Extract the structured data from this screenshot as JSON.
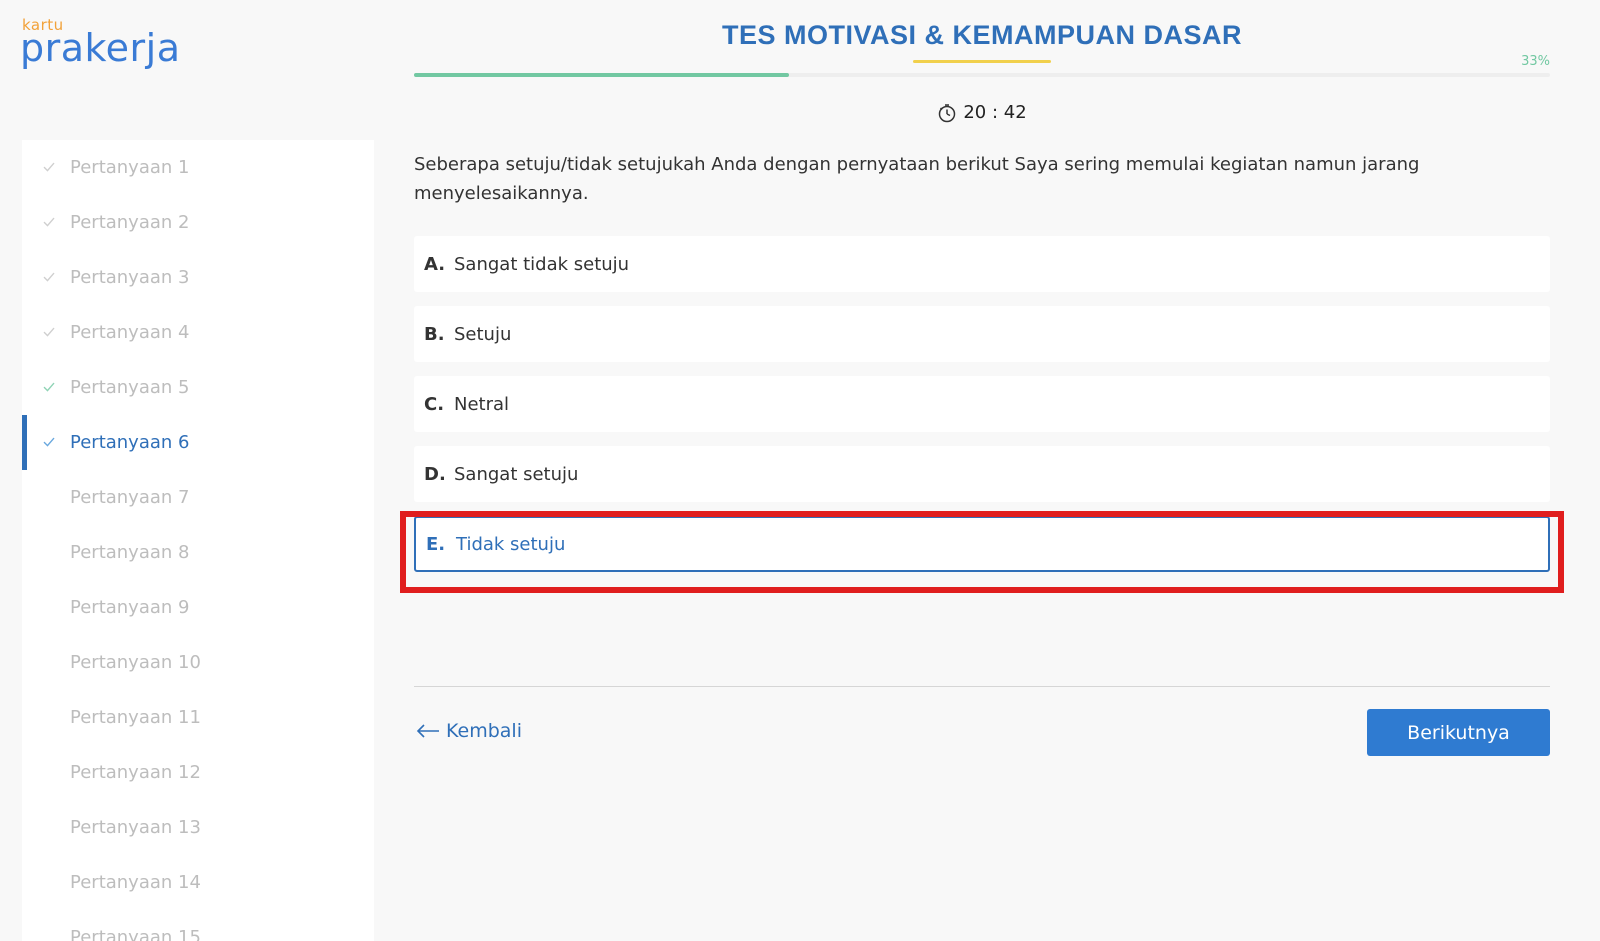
{
  "logo": {
    "small_text": "kartu",
    "main_text": "prakerja"
  },
  "header": {
    "title": "TES MOTIVASI & KEMAMPUAN DASAR",
    "progress_label": "33%",
    "progress_value": 0.33
  },
  "timer": {
    "value": "20 : 42"
  },
  "sidebar": {
    "items": [
      {
        "label": "Pertanyaan 1",
        "done": true,
        "active": false
      },
      {
        "label": "Pertanyaan 2",
        "done": true,
        "active": false
      },
      {
        "label": "Pertanyaan 3",
        "done": true,
        "active": false
      },
      {
        "label": "Pertanyaan 4",
        "done": true,
        "active": false
      },
      {
        "label": "Pertanyaan 5",
        "done": true,
        "active": false
      },
      {
        "label": "Pertanyaan 6",
        "done": true,
        "active": true
      },
      {
        "label": "Pertanyaan 7",
        "done": false,
        "active": false
      },
      {
        "label": "Pertanyaan 8",
        "done": false,
        "active": false
      },
      {
        "label": "Pertanyaan 9",
        "done": false,
        "active": false
      },
      {
        "label": "Pertanyaan 10",
        "done": false,
        "active": false
      },
      {
        "label": "Pertanyaan 11",
        "done": false,
        "active": false
      },
      {
        "label": "Pertanyaan 12",
        "done": false,
        "active": false
      },
      {
        "label": "Pertanyaan 13",
        "done": false,
        "active": false
      },
      {
        "label": "Pertanyaan 14",
        "done": false,
        "active": false
      },
      {
        "label": "Pertanyaan 15",
        "done": false,
        "active": false
      }
    ]
  },
  "question": {
    "text": "Seberapa setuju/tidak setujukah Anda dengan pernyataan berikut Saya sering memulai kegiatan namun jarang menyelesaikannya."
  },
  "options": [
    {
      "letter": "A.",
      "label": "Sangat tidak setuju",
      "selected": false
    },
    {
      "letter": "B.",
      "label": "Setuju",
      "selected": false
    },
    {
      "letter": "C.",
      "label": "Netral",
      "selected": false
    },
    {
      "letter": "D.",
      "label": "Sangat setuju",
      "selected": false
    },
    {
      "letter": "E.",
      "label": "Tidak setuju",
      "selected": true
    }
  ],
  "navigation": {
    "back_label": "Kembali",
    "next_label": "Berikutnya"
  },
  "colors": {
    "primary": "#2f6fb8",
    "progress": "#72c8a2",
    "title_accent": "#f1d04c",
    "highlight": "#e01e1e"
  }
}
